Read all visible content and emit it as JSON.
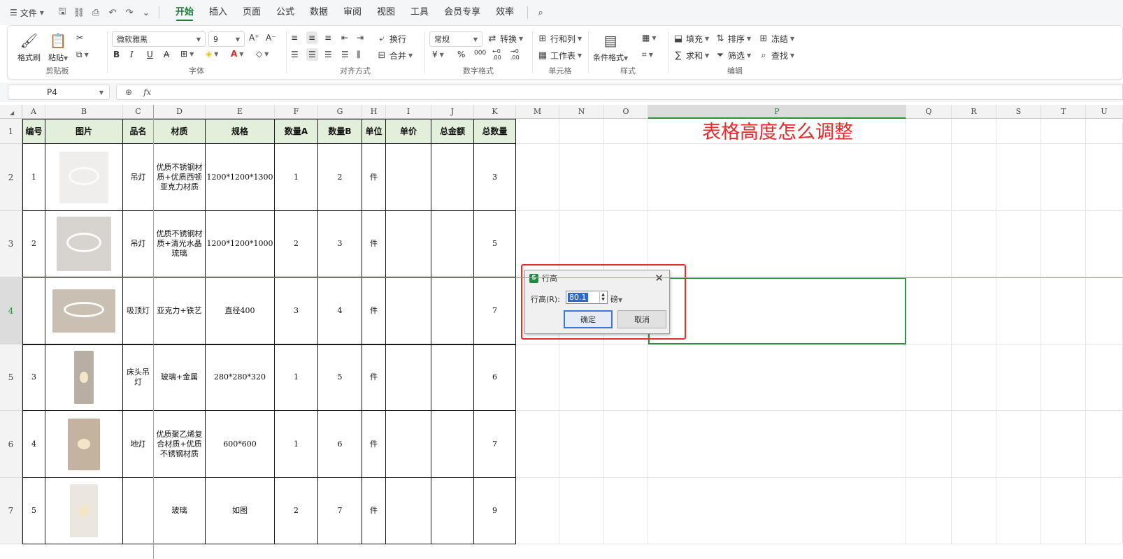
{
  "menubar": {
    "file_label": "文件",
    "tabs": [
      "开始",
      "插入",
      "页面",
      "公式",
      "数据",
      "审阅",
      "视图",
      "工具",
      "会员专享",
      "效率"
    ],
    "active_tab": "开始"
  },
  "ribbon": {
    "clipboard": {
      "group": "剪贴板",
      "format_painter": "格式刷",
      "paste": "粘贴"
    },
    "font": {
      "group": "字体",
      "font_name": "微软雅黑",
      "font_size": "9",
      "bold": "B",
      "italic": "I",
      "underline": "U",
      "strike": "A"
    },
    "align": {
      "group": "对齐方式",
      "wrap": "换行",
      "merge": "合并"
    },
    "number": {
      "group": "数字格式",
      "format": "常规",
      "convert": "转换",
      "currency": "¥",
      "percent": "%",
      "thousands": "000",
      "inc_dec": "←0 .00",
      "dec_dec": "→0 .00"
    },
    "cells": {
      "group": "单元格",
      "row_col": "行和列",
      "worksheet": "工作表"
    },
    "styles": {
      "group": "样式",
      "cond_format": "条件格式"
    },
    "edit": {
      "group": "编辑",
      "fill": "填充",
      "sort": "排序",
      "freeze": "冻结",
      "sum": "求和",
      "filter": "筛选",
      "find": "查找"
    }
  },
  "formula_bar": {
    "cell_ref": "P4",
    "fx": "fx",
    "value": ""
  },
  "columns": [
    "A",
    "B",
    "C",
    "D",
    "E",
    "F",
    "G",
    "H",
    "I",
    "J",
    "K",
    "M",
    "N",
    "O",
    "P",
    "Q",
    "R",
    "S",
    "T",
    "U"
  ],
  "rows": [
    "1",
    "2",
    "3",
    "4",
    "5",
    "6",
    "7"
  ],
  "table": {
    "headers": [
      "编号",
      "图片",
      "品名",
      "材质",
      "规格",
      "数量A",
      "数量B",
      "单位",
      "单价",
      "总金额",
      "总数量"
    ],
    "rows": [
      [
        "1",
        "",
        "吊灯",
        "优质不锈钢材质+优质西顿亚克力材质",
        "1200*1200*1300",
        "1",
        "2",
        "件",
        "",
        "",
        "3"
      ],
      [
        "2",
        "",
        "吊灯",
        "优质不锈钢材质+清光水晶琉璃",
        "1200*1200*1000",
        "2",
        "3",
        "件",
        "",
        "",
        "5"
      ],
      [
        "",
        "",
        "吸顶灯",
        "亚克力+铁艺",
        "直径400",
        "3",
        "4",
        "件",
        "",
        "",
        "7"
      ],
      [
        "3",
        "",
        "床头吊灯",
        "玻璃+金属",
        "280*280*320",
        "1",
        "5",
        "件",
        "",
        "",
        "6"
      ],
      [
        "4",
        "",
        "地灯",
        "优质聚乙烯复合材质+优质不锈钢材质",
        "600*600",
        "1",
        "6",
        "件",
        "",
        "",
        "7"
      ],
      [
        "5",
        "",
        "",
        "玻璃",
        "如图",
        "2",
        "7",
        "件",
        "",
        "",
        "9"
      ]
    ]
  },
  "annotation": {
    "title": "表格高度怎么调整",
    "color": "#e82a2a"
  },
  "dialog": {
    "title": "行高",
    "app_badge": "S",
    "label": "行高(R):",
    "value": "80.1",
    "unit": "磅",
    "ok": "确定",
    "cancel": "取消"
  },
  "colors": {
    "accent": "#1e7b3a",
    "header_fill": "#e2efda",
    "selection": "#2f8f3f",
    "highlight": "#e62e2e"
  }
}
